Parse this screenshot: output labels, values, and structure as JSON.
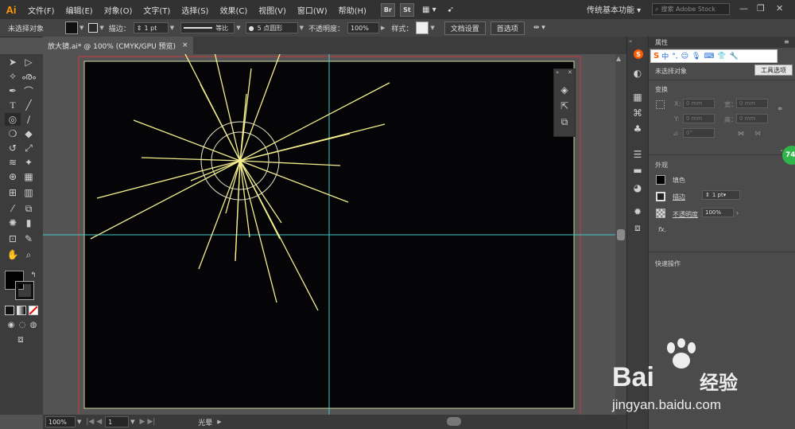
{
  "app": {
    "logo": "Ai"
  },
  "menu": [
    "文件(F)",
    "编辑(E)",
    "对象(O)",
    "文字(T)",
    "选择(S)",
    "效果(C)",
    "视图(V)",
    "窗口(W)",
    "帮助(H)"
  ],
  "bridge_label": "Br",
  "stock_label": "St",
  "workspace": "传统基本功能",
  "search": {
    "placeholder": "搜索 Adobe Stock"
  },
  "control": {
    "selection": "未选择对象",
    "stroke_label": "描边：",
    "stroke_value": "1 pt",
    "profile_label": "等比",
    "brush_value": "5 点圆形",
    "opacity_label": "不透明度：",
    "opacity_value": "100%",
    "style_label": "样式：",
    "doc_setup": "文档设置",
    "prefs": "首选项"
  },
  "document_tab": {
    "title": "放大镜.ai* @ 100% (CMYK/GPU 预览)",
    "close": "×"
  },
  "status": {
    "zoom": "100%",
    "page": "1",
    "tool": "光晕"
  },
  "ime": {
    "label": "中"
  },
  "properties": {
    "tab_label": "属性",
    "selection_title": "未选择对象",
    "tool_options": "工具选项",
    "transform_title": "变换",
    "x_label": "X:",
    "x_value": "0 mm",
    "y_label": "Y:",
    "y_value": "0 mm",
    "w_label": "宽：",
    "w_value": "0 mm",
    "h_label": "高：",
    "h_value": "0 mm",
    "angle_value": "0°",
    "appearance_title": "外观",
    "fill_label": "填色",
    "stroke_label": "描边",
    "stroke_value": "1 pt",
    "opacity_label": "不透明度",
    "opacity_value": "100%",
    "fx_label": "fx.",
    "quick_actions": "快速操作"
  },
  "badge": "74",
  "watermark": {
    "brand": "Bai",
    "brand_suffix": "经验",
    "url": "jingyan.baidu.com"
  },
  "colors": {
    "flare": "#f4ef8c",
    "guide": "#00c8c8",
    "artboard": "#050508",
    "bleed": "#c8383e",
    "accent": "#ff9a00"
  }
}
